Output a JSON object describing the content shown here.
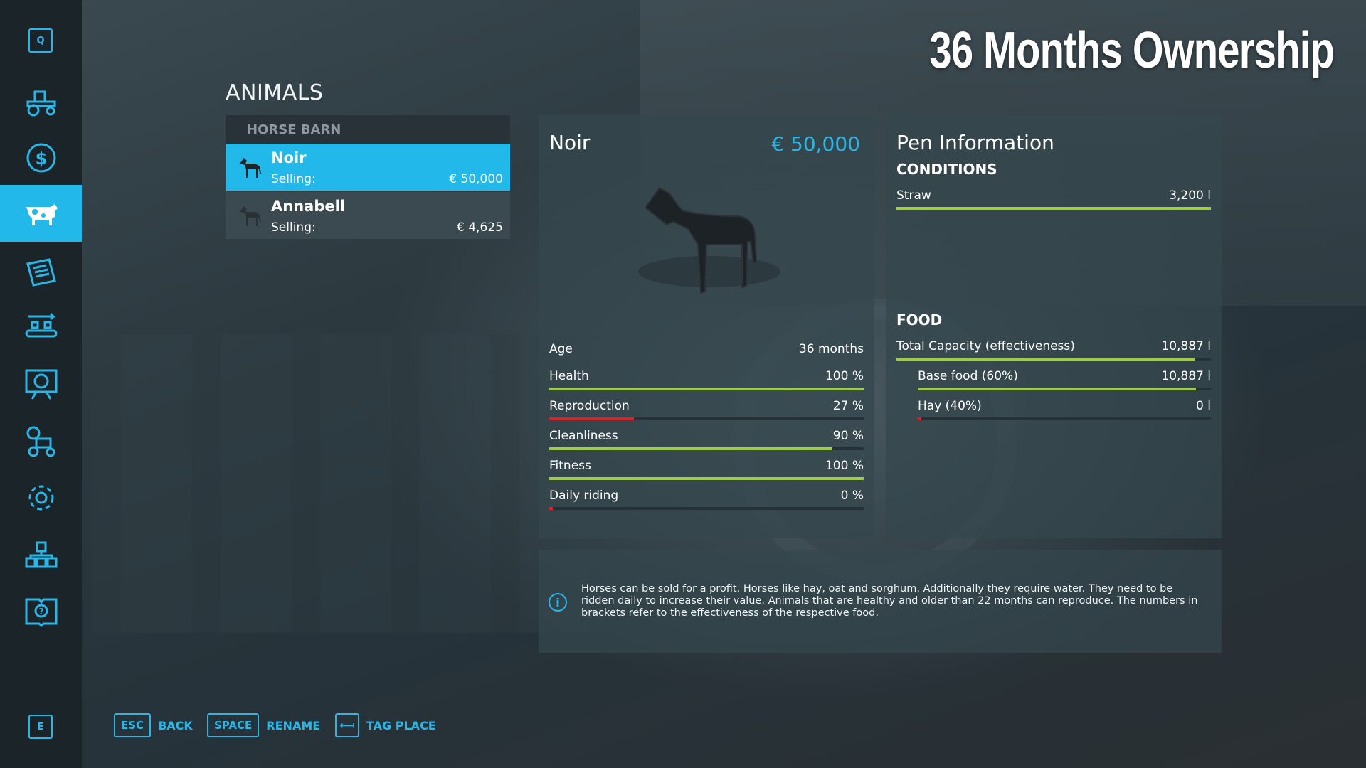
{
  "header": {
    "title": "36 Months Ownership"
  },
  "sidebar": {
    "top_key": "Q",
    "bottom_key": "E",
    "items": [
      {
        "icon": "tractor-icon",
        "active": false
      },
      {
        "icon": "dollar-icon",
        "active": false
      },
      {
        "icon": "cow-icon",
        "active": true
      },
      {
        "icon": "contracts-icon",
        "active": false
      },
      {
        "icon": "production-icon",
        "active": false
      },
      {
        "icon": "statistics-icon",
        "active": false
      },
      {
        "icon": "garage-icon",
        "active": false
      },
      {
        "icon": "settings-icon",
        "active": false
      },
      {
        "icon": "placeables-icon",
        "active": false
      },
      {
        "icon": "help-book-icon",
        "active": false
      }
    ],
    "accent": "#22b8ea"
  },
  "section_title": "ANIMALS",
  "list": {
    "header": "HORSE BARN",
    "animals": [
      {
        "name": "Noir",
        "selling_label": "Selling:",
        "price": "€ 50,000",
        "selected": true
      },
      {
        "name": "Annabell",
        "selling_label": "Selling:",
        "price": "€ 4,625",
        "selected": false
      }
    ]
  },
  "animal": {
    "name": "Noir",
    "price": "€ 50,000",
    "age_label": "Age",
    "age_value": "36 months",
    "stats": [
      {
        "label": "Health",
        "value": "100 %",
        "fraction": 1.0,
        "color": "#9ccd45"
      },
      {
        "label": "Reproduction",
        "value": "27 %",
        "fraction": 0.27,
        "color": "#d8232a"
      },
      {
        "label": "Cleanliness",
        "value": "90 %",
        "fraction": 0.9,
        "color": "#9ccd45"
      },
      {
        "label": "Fitness",
        "value": "100 %",
        "fraction": 1.0,
        "color": "#9ccd45"
      },
      {
        "label": "Daily riding",
        "value": "0 %",
        "fraction": 0.0,
        "color": "#d8232a"
      }
    ]
  },
  "pen": {
    "title": "Pen Information",
    "conditions_label": "CONDITIONS",
    "conditions": [
      {
        "label": "Straw",
        "value": "3,200 l",
        "fraction": 1.0,
        "color": "#9ccd45"
      }
    ],
    "food_label": "FOOD",
    "total": {
      "label": "Total Capacity (effectiveness)",
      "value": "10,887 l",
      "fraction": 0.95,
      "color": "#9ccd45"
    },
    "food": [
      {
        "label": "Base food (60%)",
        "value": "10,887 l",
        "fraction": 0.95,
        "color": "#9ccd45"
      },
      {
        "label": "Hay (40%)",
        "value": "0 l",
        "fraction": 0.0,
        "color": "#d8232a"
      }
    ]
  },
  "info": {
    "text": "Horses can be sold for a profit. Horses like hay, oat and sorghum. Additionally they require water. They need to be ridden daily to increase their value. Animals that are healthy and older than 22 months can reproduce. The numbers in brackets refer to the effectiveness of the respective food."
  },
  "footer": {
    "back": {
      "key": "ESC",
      "label": "BACK"
    },
    "rename": {
      "key": "SPACE",
      "label": "RENAME"
    },
    "tag": {
      "key": "⟻",
      "label": "TAG PLACE"
    }
  }
}
